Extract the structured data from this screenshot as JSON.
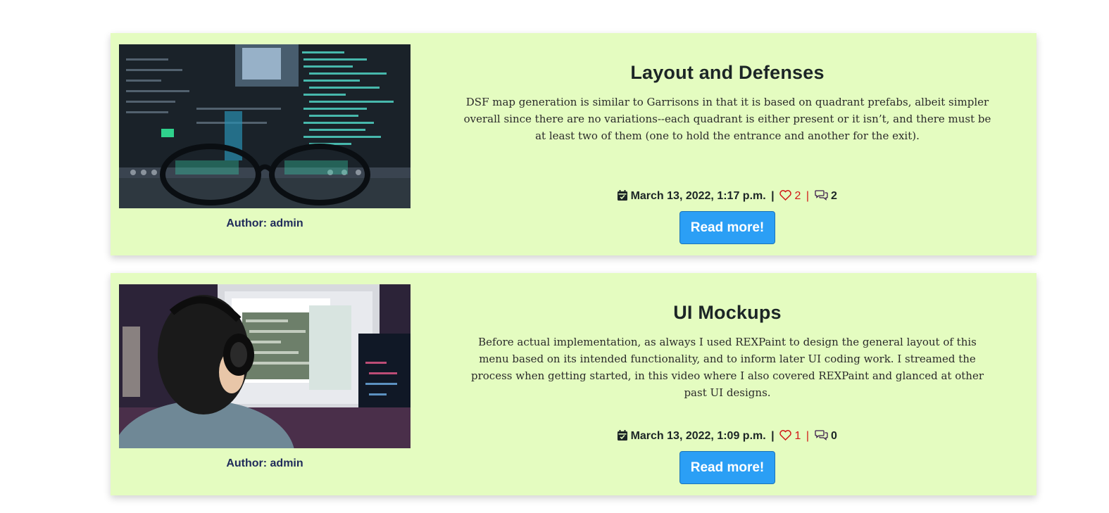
{
  "posts": [
    {
      "title": "Layout and Defenses",
      "excerpt": "DSF map generation is similar to Garrisons in that it is based on quadrant prefabs, albeit simpler overall since there are no variations--each quadrant is either present or it isn’t, and there must be at least two of them (one to hold the entrance and another for the exit).",
      "author": "Author: admin",
      "date": "March 13, 2022, 1:17 p.m.",
      "likes": "2",
      "comments": "2",
      "read_more": "Read more!"
    },
    {
      "title": "UI Mockups",
      "excerpt": "Before actual implementation, as always I used REXPaint to design the general layout of this menu based on its intended functionality, and to inform later UI coding work. I streamed the process when getting started, in this video where I also covered REXPaint and glanced at other past UI designs.",
      "author": "Author: admin",
      "date": "March 13, 2022, 1:09 p.m.",
      "likes": "1",
      "comments": "0",
      "read_more": "Read more!"
    }
  ],
  "separator": "|",
  "icons": {
    "calendar": "calendar-check-icon",
    "heart": "heart-icon",
    "comments": "comments-icon"
  },
  "colors": {
    "card_background": "#e4fcc0",
    "button": "#2b9ff5",
    "like": "#d11818",
    "author": "#1f2a5a"
  }
}
